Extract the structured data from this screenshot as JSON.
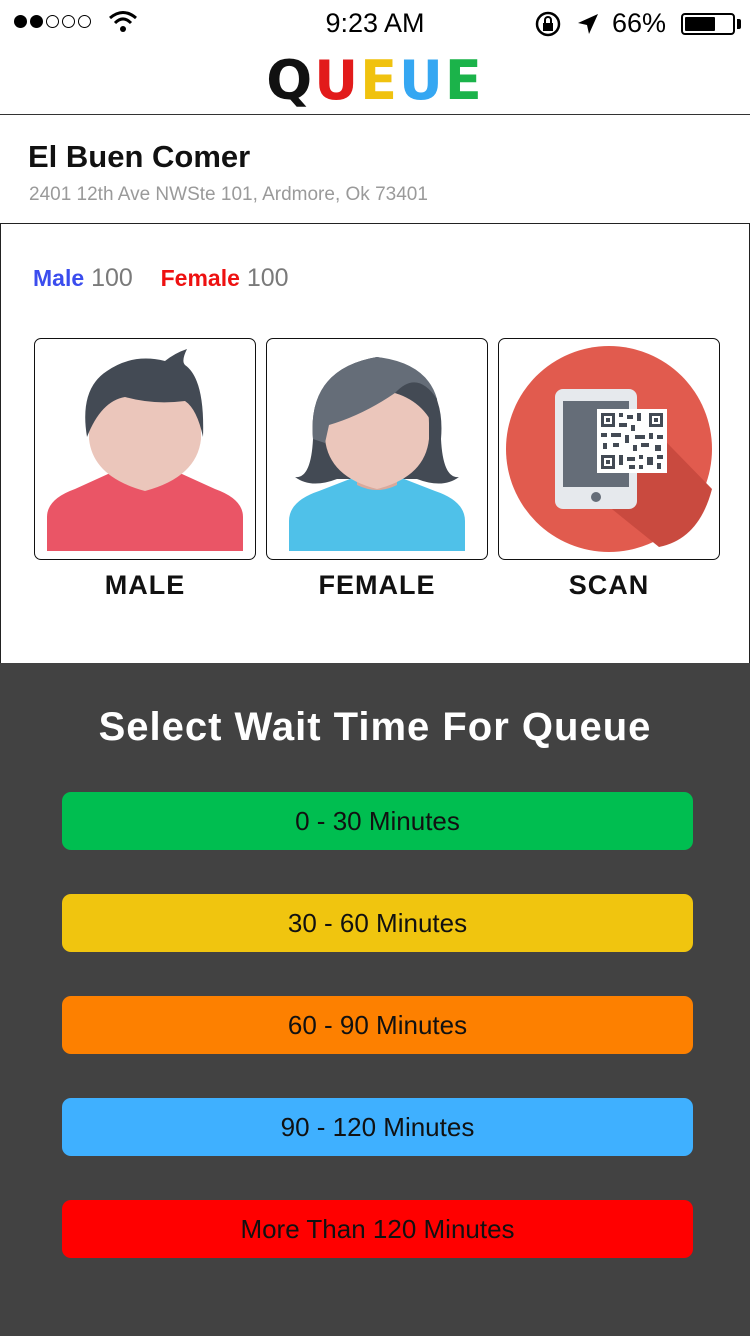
{
  "status_bar": {
    "time": "9:23 AM",
    "battery_percent": "66%",
    "battery_level": 0.66,
    "signal_bars_filled": 2,
    "signal_bars_total": 5
  },
  "app": {
    "logo_letters": [
      {
        "char": "Q",
        "color": "#111111"
      },
      {
        "char": "U",
        "color": "#e21b1b"
      },
      {
        "char": "E",
        "color": "#f0c20f"
      },
      {
        "char": "U",
        "color": "#35a7f2"
      },
      {
        "char": "E",
        "color": "#1bb34a"
      }
    ]
  },
  "restaurant": {
    "name": "El Buen Comer",
    "address": "2401 12th Ave NWSte 101, Ardmore, Ok 73401"
  },
  "counts": {
    "male_label": "Male",
    "male_value": "100",
    "female_label": "Female",
    "female_value": "100"
  },
  "options": {
    "male_label": "MALE",
    "female_label": "FEMALE",
    "scan_label": "SCAN",
    "male_icon": "male-avatar-icon",
    "female_icon": "female-avatar-icon",
    "scan_icon": "qr-scan-icon"
  },
  "wait": {
    "title": "Select Wait Time For Queue",
    "buttons": [
      {
        "label": "0 - 30 Minutes",
        "color": "#00be50"
      },
      {
        "label": "30 - 60 Minutes",
        "color": "#f0c50f"
      },
      {
        "label": "60 - 90 Minutes",
        "color": "#fd8000"
      },
      {
        "label": "90 - 120 Minutes",
        "color": "#3fb0ff"
      },
      {
        "label": "More Than 120 Minutes",
        "color": "#ff0000"
      }
    ]
  }
}
